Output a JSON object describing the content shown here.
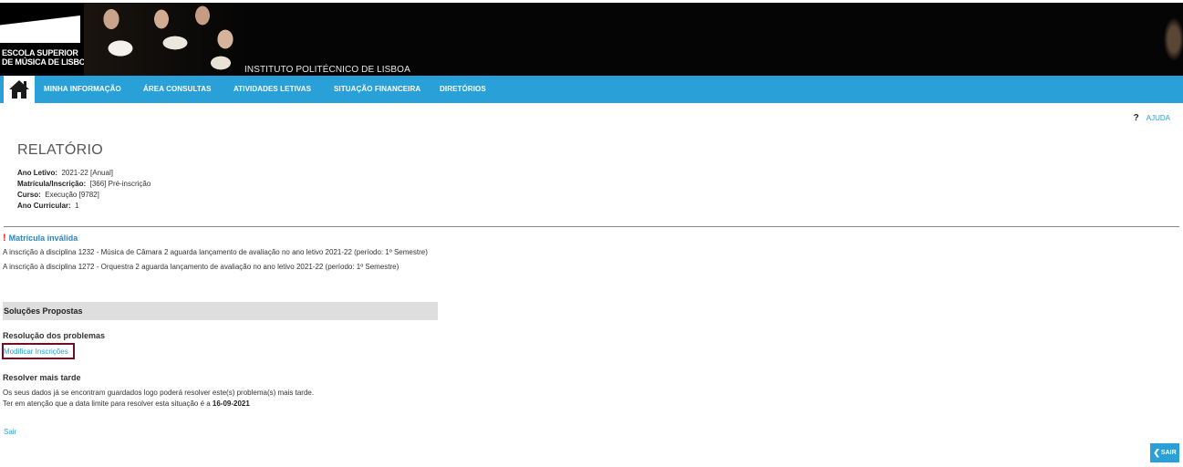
{
  "header": {
    "logo_line1": "ESCOLA SUPERIOR",
    "logo_line2": "DE MÚSICA DE LISBOA",
    "institution": "INSTITUTO POLITÉCNICO DE LISBOA"
  },
  "nav": {
    "items": [
      {
        "label": "MINHA INFORMAÇÃO"
      },
      {
        "label": "ÁREA CONSULTAS"
      },
      {
        "label": "ATIVIDADES LETIVAS"
      },
      {
        "label": "SITUAÇÃO FINANCEIRA"
      },
      {
        "label": "DIRETÓRIOS"
      }
    ]
  },
  "help": {
    "symbol": "?",
    "label": "AJUDA"
  },
  "report": {
    "title": "RELATÓRIO",
    "fields": [
      {
        "label": "Ano Letivo:",
        "value": "2021-22 [Anual]"
      },
      {
        "label": "Matrícula/Inscrição:",
        "value": "[366] Pré-inscrição"
      },
      {
        "label": "Curso:",
        "value": "Execução [9782]"
      },
      {
        "label": "Ano Curricular:",
        "value": "1"
      }
    ]
  },
  "error": {
    "symbol": "!",
    "title": "Matrícula inválida",
    "lines": [
      "A inscrição à disciplina 1232 - Música de Câmara 2 aguarda lançamento de avaliação no ano letivo 2021-22 (período: 1º Semestre)",
      "A inscrição à disciplina 1272 - Orquestra 2 aguarda lançamento de avaliação no ano letivo 2021-22 (período: 1º Semestre)"
    ]
  },
  "solutions": {
    "header": "Soluções Propostas",
    "resolution_title": "Resolução dos problemas",
    "modify_link": "Modificar Inscrições",
    "later_title": "Resolver mais tarde",
    "later_text1": "Os seus dados já se encontram guardados logo poderá resolver este(s) problema(s) mais tarde.",
    "later_text2_prefix": "Ter em atenção que a data limite para resolver esta situação é a ",
    "later_text2_date": "16-09-2021"
  },
  "footer": {
    "sair_link": "Sair",
    "sair_button": "SAIR"
  },
  "colors": {
    "nav": "#2aa0d8",
    "link": "#2aa0d8",
    "highlight_border": "#6b0f24",
    "error_bang": "#e4261b"
  }
}
